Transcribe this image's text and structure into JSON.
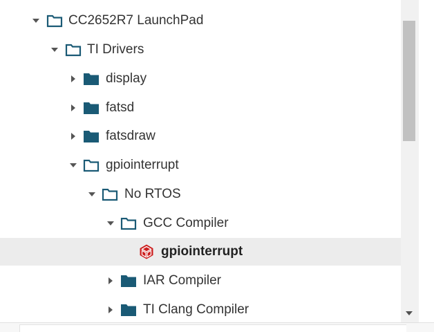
{
  "tree": {
    "items": [
      {
        "label": "CC2652R7 LaunchPad",
        "state": "expanded",
        "kind": "folder",
        "selected": false
      },
      {
        "label": "TI Drivers",
        "state": "expanded",
        "kind": "folder",
        "selected": false
      },
      {
        "label": "display",
        "state": "collapsed",
        "kind": "folder",
        "selected": false
      },
      {
        "label": "fatsd",
        "state": "collapsed",
        "kind": "folder",
        "selected": false
      },
      {
        "label": "fatsdraw",
        "state": "collapsed",
        "kind": "folder",
        "selected": false
      },
      {
        "label": "gpiointerrupt",
        "state": "expanded",
        "kind": "folder",
        "selected": false
      },
      {
        "label": "No RTOS",
        "state": "expanded",
        "kind": "folder",
        "selected": false
      },
      {
        "label": "GCC Compiler",
        "state": "expanded",
        "kind": "folder",
        "selected": false
      },
      {
        "label": "gpiointerrupt",
        "state": "leaf",
        "kind": "project",
        "selected": true
      },
      {
        "label": "IAR Compiler",
        "state": "collapsed",
        "kind": "folder",
        "selected": false
      },
      {
        "label": "TI Clang Compiler",
        "state": "collapsed",
        "kind": "folder",
        "selected": false
      }
    ]
  },
  "icons": {
    "expanded_toggle": "caret-down-icon",
    "collapsed_toggle": "caret-right-icon",
    "open_folder": "folder-outline-icon",
    "closed_folder": "folder-filled-icon",
    "project": "project-cube-icon",
    "scroll_down": "scroll-down-arrow-icon"
  },
  "colors": {
    "folder": "#1a5a75",
    "project": "#cc1f1f",
    "text": "#333333",
    "selected_bg": "#ececec",
    "scroll_thumb": "#c1c1c1"
  }
}
